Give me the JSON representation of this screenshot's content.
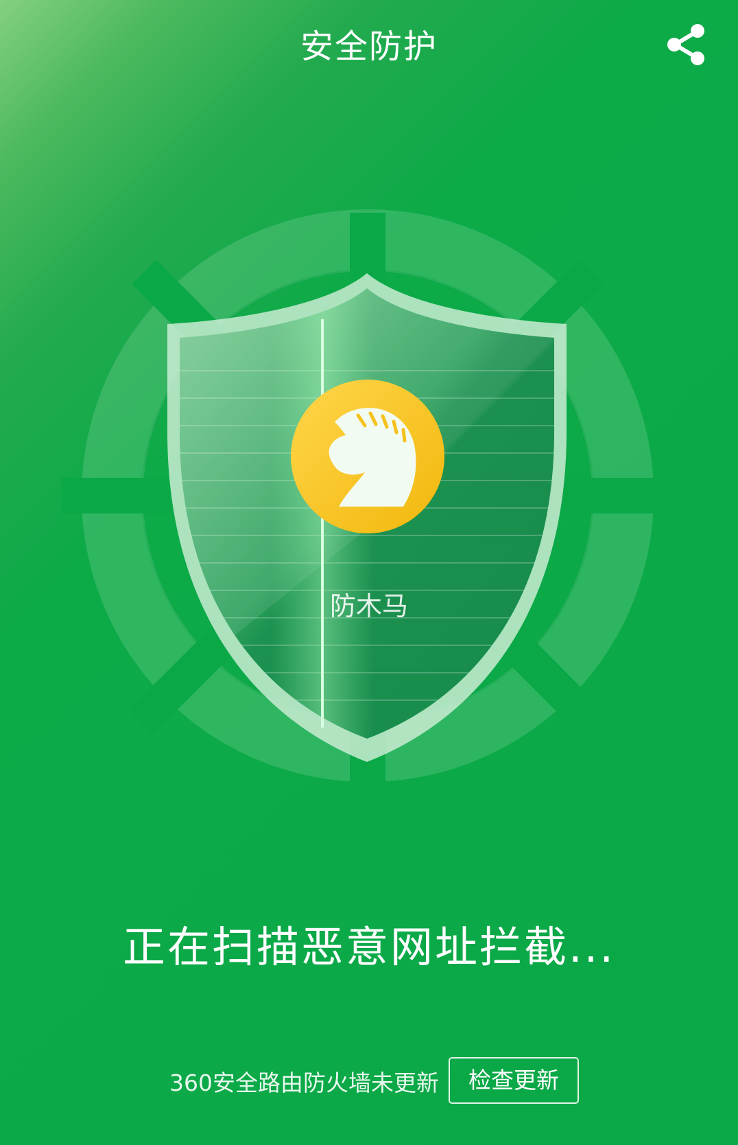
{
  "header": {
    "title": "安全防护",
    "share_icon": "share-icon"
  },
  "scan": {
    "module_label": "防木马",
    "module_icon": "knight-chess-icon",
    "status_text": "正在扫描恶意网址拦截..."
  },
  "footer": {
    "note": "360安全路由防火墙未更新",
    "check_update_label": "检查更新"
  },
  "colors": {
    "background": "#0aa847",
    "background_highlight": "#84d07f",
    "shield_border": "#c9ecd3",
    "badge_gold": "#f6c21c"
  }
}
